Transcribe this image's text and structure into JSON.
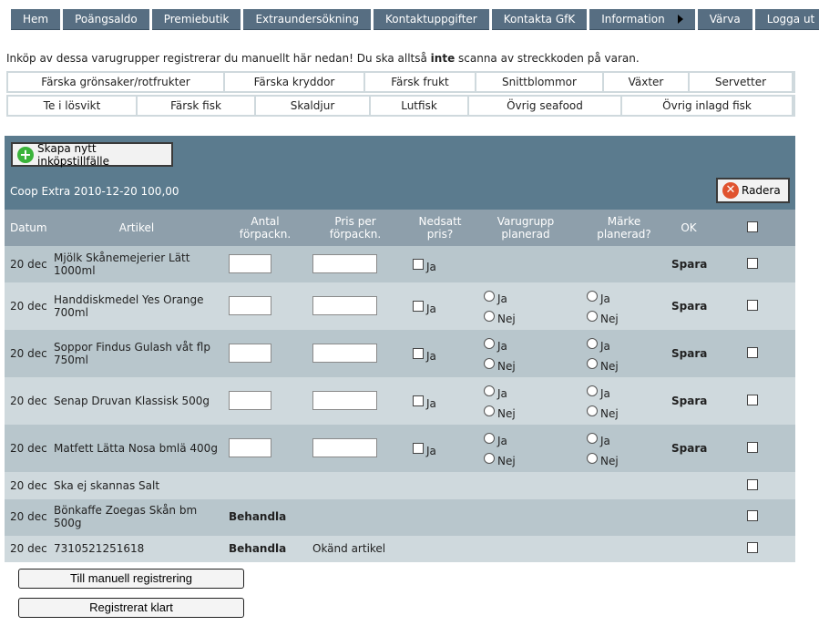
{
  "nav": [
    "Hem",
    "Poängsaldo",
    "Premiebutik",
    "Extraundersökning",
    "Kontaktuppgifter",
    "Kontakta GfK",
    "Information",
    "Värva",
    "Logga ut"
  ],
  "intro": {
    "before": "Inköp av dessa varugrupper registrerar du manuellt här nedan! Du ska alltså ",
    "bold": "inte",
    "after": " scanna av streckkoden på varan."
  },
  "categories_row1": [
    "Färska grönsaker/rotfrukter",
    "Färska kryddor",
    "Färsk frukt",
    "Snittblommor",
    "Växter",
    "Servetter"
  ],
  "categories_row2": [
    "Te i lösvikt",
    "Färsk fisk",
    "Skaldjur",
    "Lutfisk",
    "Övrig seafood",
    "Övrig inlagd fisk"
  ],
  "panel": {
    "create_label": "Skapa nytt inköpstillfälle",
    "receipt": "Coop Extra 2010-12-20 100,00",
    "delete_label": "Radera"
  },
  "table": {
    "headers": {
      "datum": "Datum",
      "artikel": "Artikel",
      "antal_1": "Antal",
      "antal_2": "förpackn.",
      "pris_1": "Pris per",
      "pris_2": "förpackn.",
      "nedsatt_1": "Nedsatt",
      "nedsatt_2": "pris?",
      "varugrupp_1": "Varugrupp",
      "varugrupp_2": "planerad",
      "marke_1": "Märke",
      "marke_2": "planerad?",
      "ok": "OK"
    },
    "yes": "Ja",
    "no": "Nej",
    "save": "Spara",
    "process": "Behandla",
    "unknown": "Okänd artikel",
    "rows": [
      {
        "date": "20 dec",
        "article_1": "Mjölk Skånemejerier Lätt",
        "article_2": "1000ml"
      },
      {
        "date": "20 dec",
        "article_1": "Handdiskmedel Yes Orange",
        "article_2": "700ml"
      },
      {
        "date": "20 dec",
        "article_1": "Soppor Findus Gulash våt flp",
        "article_2": "750ml"
      },
      {
        "date": "20 dec",
        "article_1": "Senap Druvan Klassisk 500g",
        "article_2": ""
      },
      {
        "date": "20 dec",
        "article_1": "Matfett Lätta Nosa bmlä 400g",
        "article_2": ""
      },
      {
        "date": "20 dec",
        "article_1": "Ska ej skannas Salt",
        "article_2": ""
      },
      {
        "date": "20 dec",
        "article_1": "Bönkaffe Zoegas Skån bm",
        "article_2": "500g"
      },
      {
        "date": "20 dec",
        "article_1": "7310521251618",
        "article_2": ""
      }
    ]
  },
  "buttons": {
    "manual": "Till manuell registrering",
    "done": "Registrerat klart"
  },
  "colors": {
    "nav": "#576e82",
    "panel_head": "#5b7b8e",
    "table_head": "#8e9fab",
    "row_dark": "#b8c6cc",
    "row_light": "#cfd9dd"
  }
}
